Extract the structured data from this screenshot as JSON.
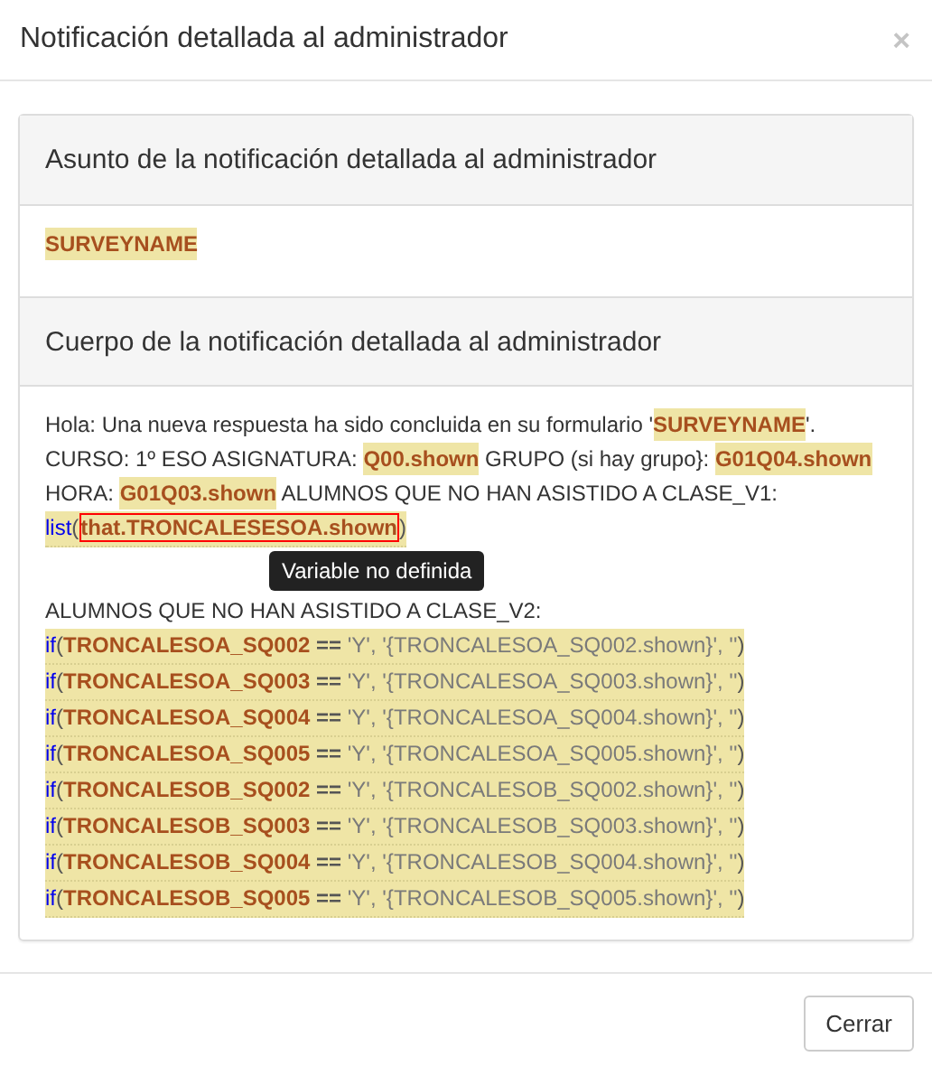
{
  "dialog": {
    "title": "Notificación detallada al administrador",
    "close": "×"
  },
  "subject": {
    "heading": "Asunto de la notificación detallada al administrador",
    "content": [
      {
        "kind": "field",
        "text": "SURVEYNAME"
      }
    ]
  },
  "body": {
    "heading": "Cuerpo de la notificación detallada al administrador",
    "blocks": [
      [
        {
          "expr": false,
          "segments": [
            {
              "kind": "text",
              "text": "Hola: Una nueva respuesta ha sido concluida en su formulario '"
            },
            {
              "kind": "field",
              "text": "SURVEYNAME"
            },
            {
              "kind": "text",
              "text": "'."
            }
          ]
        },
        {
          "expr": false,
          "segments": [
            {
              "kind": "text",
              "text": "CURSO: 1º ESO ASIGNATURA: "
            },
            {
              "kind": "field",
              "text": "Q00.shown"
            },
            {
              "kind": "text",
              "text": " GRUPO (si hay grupo}: "
            },
            {
              "kind": "field",
              "text": "G01Q04.shown"
            }
          ]
        },
        {
          "expr": false,
          "segments": [
            {
              "kind": "text",
              "text": "HORA: "
            },
            {
              "kind": "field",
              "text": "G01Q03.shown"
            },
            {
              "kind": "text",
              "text": " ALUMNOS QUE NO HAN ASISTIDO A CLASE_V1:"
            }
          ]
        },
        {
          "expr": true,
          "segments": [
            {
              "kind": "fn",
              "text": "list"
            },
            {
              "kind": "punc",
              "text": "("
            },
            {
              "kind": "var",
              "text": "that.TRONCALESESOA.shown",
              "error": true
            },
            {
              "kind": "punc",
              "text": ")"
            }
          ]
        }
      ],
      [
        {
          "expr": false,
          "segments": [
            {
              "kind": "text",
              "text": "ALUMNOS QUE NO HAN ASISTIDO A CLASE_V2:"
            }
          ]
        },
        {
          "expr": true,
          "segments": [
            {
              "kind": "fn",
              "text": "if"
            },
            {
              "kind": "punc",
              "text": "("
            },
            {
              "kind": "var",
              "text": "TRONCALESOA_SQ002",
              "error": false
            },
            {
              "kind": "op",
              "text": " == "
            },
            {
              "kind": "str",
              "text": "'Y', '{TRONCALESOA_SQ002.shown}', ''"
            },
            {
              "kind": "punc",
              "text": ")"
            }
          ]
        },
        {
          "expr": true,
          "segments": [
            {
              "kind": "fn",
              "text": "if"
            },
            {
              "kind": "punc",
              "text": "("
            },
            {
              "kind": "var",
              "text": "TRONCALESOA_SQ003",
              "error": false
            },
            {
              "kind": "op",
              "text": " == "
            },
            {
              "kind": "str",
              "text": "'Y', '{TRONCALESOA_SQ003.shown}', ''"
            },
            {
              "kind": "punc",
              "text": ")"
            }
          ]
        },
        {
          "expr": true,
          "segments": [
            {
              "kind": "fn",
              "text": "if"
            },
            {
              "kind": "punc",
              "text": "("
            },
            {
              "kind": "var",
              "text": "TRONCALESOA_SQ004",
              "error": false
            },
            {
              "kind": "op",
              "text": " == "
            },
            {
              "kind": "str",
              "text": "'Y', '{TRONCALESOA_SQ004.shown}', ''"
            },
            {
              "kind": "punc",
              "text": ")"
            }
          ]
        },
        {
          "expr": true,
          "segments": [
            {
              "kind": "fn",
              "text": "if"
            },
            {
              "kind": "punc",
              "text": "("
            },
            {
              "kind": "var",
              "text": "TRONCALESOA_SQ005",
              "error": false
            },
            {
              "kind": "op",
              "text": " == "
            },
            {
              "kind": "str",
              "text": "'Y', '{TRONCALESOA_SQ005.shown}', ''"
            },
            {
              "kind": "punc",
              "text": ")"
            }
          ]
        },
        {
          "expr": true,
          "segments": [
            {
              "kind": "fn",
              "text": "if"
            },
            {
              "kind": "punc",
              "text": "("
            },
            {
              "kind": "var",
              "text": "TRONCALESOB_SQ002",
              "error": false
            },
            {
              "kind": "op",
              "text": " == "
            },
            {
              "kind": "str",
              "text": "'Y', '{TRONCALESOB_SQ002.shown}', ''"
            },
            {
              "kind": "punc",
              "text": ")"
            }
          ]
        },
        {
          "expr": true,
          "segments": [
            {
              "kind": "fn",
              "text": "if"
            },
            {
              "kind": "punc",
              "text": "("
            },
            {
              "kind": "var",
              "text": "TRONCALESOB_SQ003",
              "error": false
            },
            {
              "kind": "op",
              "text": " == "
            },
            {
              "kind": "str",
              "text": "'Y', '{TRONCALESOB_SQ003.shown}', ''"
            },
            {
              "kind": "punc",
              "text": ")"
            }
          ]
        },
        {
          "expr": true,
          "segments": [
            {
              "kind": "fn",
              "text": "if"
            },
            {
              "kind": "punc",
              "text": "("
            },
            {
              "kind": "var",
              "text": "TRONCALESOB_SQ004",
              "error": false
            },
            {
              "kind": "op",
              "text": " == "
            },
            {
              "kind": "str",
              "text": "'Y', '{TRONCALESOB_SQ004.shown}', ''"
            },
            {
              "kind": "punc",
              "text": ")"
            }
          ]
        },
        {
          "expr": true,
          "segments": [
            {
              "kind": "fn",
              "text": "if"
            },
            {
              "kind": "punc",
              "text": "("
            },
            {
              "kind": "var",
              "text": "TRONCALESOB_SQ005",
              "error": false
            },
            {
              "kind": "op",
              "text": " == "
            },
            {
              "kind": "str",
              "text": "'Y', '{TRONCALESOB_SQ005.shown}', ''"
            },
            {
              "kind": "punc",
              "text": ")"
            }
          ]
        }
      ]
    ]
  },
  "tooltip": "Variable no definida",
  "buttons": [
    "Cerrar"
  ]
}
